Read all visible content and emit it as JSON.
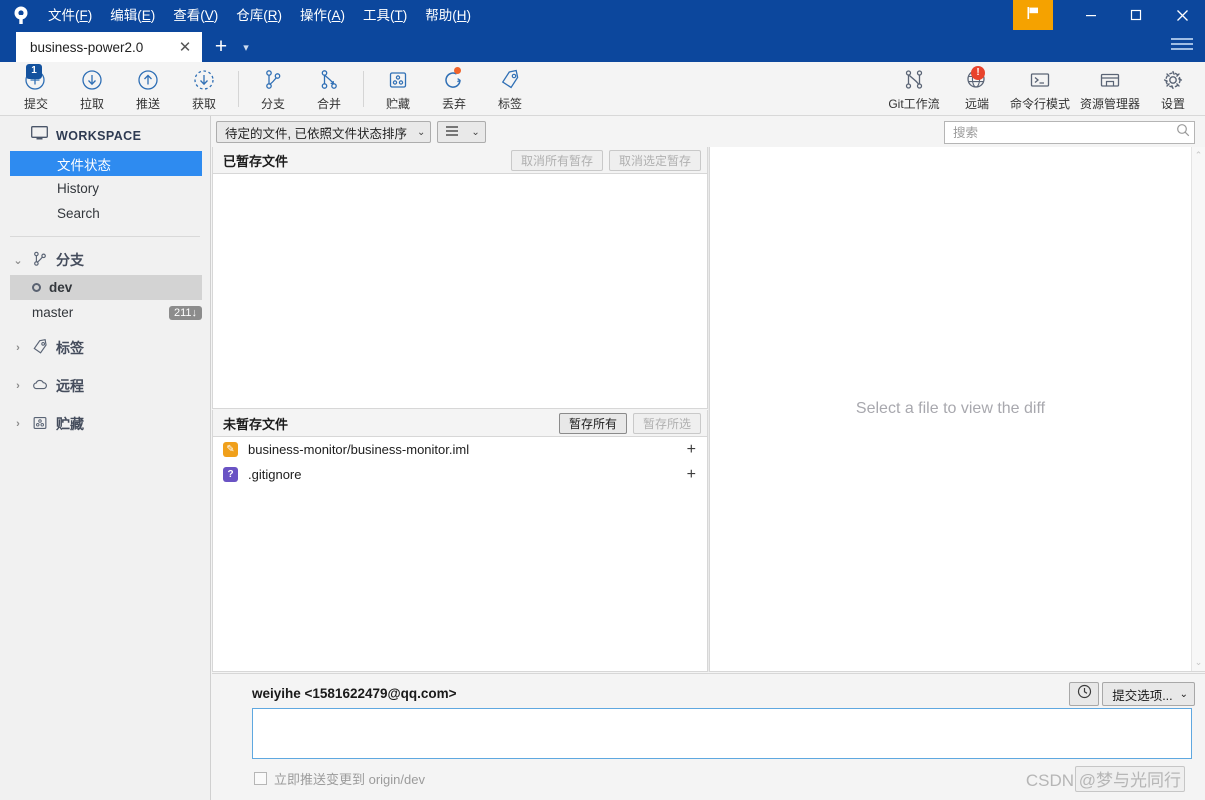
{
  "window": {
    "app_logo": "sourcetree-logo-icon",
    "minimize": "minimize-icon",
    "maximize": "maximize-icon",
    "close": "close-icon",
    "flag": "flag-icon",
    "hamburger": "hamburger-menu-icon",
    "menus": [
      {
        "label": "文件",
        "accel": "F"
      },
      {
        "label": "编辑",
        "accel": "E"
      },
      {
        "label": "查看",
        "accel": "V"
      },
      {
        "label": "仓库",
        "accel": "R"
      },
      {
        "label": "操作",
        "accel": "A"
      },
      {
        "label": "工具",
        "accel": "T"
      },
      {
        "label": "帮助",
        "accel": "H"
      }
    ]
  },
  "tabs": {
    "active": "business-power2.0",
    "close_label": "✕",
    "add_label": "+",
    "caret_label": "▾"
  },
  "toolbar": {
    "left": [
      {
        "label": "提交",
        "icon": "commit-plus-icon",
        "badge": "1"
      },
      {
        "label": "拉取",
        "icon": "pull-down-arrow-icon"
      },
      {
        "label": "推送",
        "icon": "push-up-arrow-icon"
      },
      {
        "label": "获取",
        "icon": "fetch-dashed-arrow-icon"
      },
      {
        "label": "分支",
        "icon": "branch-icon"
      },
      {
        "label": "合并",
        "icon": "merge-icon"
      },
      {
        "label": "贮藏",
        "icon": "stash-icon"
      },
      {
        "label": "丢弃",
        "icon": "discard-refresh-icon",
        "dot": true
      },
      {
        "label": "标签",
        "icon": "tag-icon"
      }
    ],
    "right": [
      {
        "label": "Git工作流",
        "icon": "gitflow-icon"
      },
      {
        "label": "远端",
        "icon": "remote-globe-icon",
        "alert": "!"
      },
      {
        "label": "命令行模式",
        "icon": "terminal-icon"
      },
      {
        "label": "资源管理器",
        "icon": "explorer-folder-icon"
      },
      {
        "label": "设置",
        "icon": "gear-icon"
      }
    ]
  },
  "sidebar": {
    "workspace_label": "WORKSPACE",
    "workspace_icon": "monitor-icon",
    "workspace_items": [
      {
        "label": "文件状态",
        "selected": true
      },
      {
        "label": "History",
        "selected": false
      },
      {
        "label": "Search",
        "selected": false
      }
    ],
    "groups": [
      {
        "label": "分支",
        "icon": "branch-icon",
        "expanded": true,
        "chevron": "⌄",
        "branches": [
          {
            "name": "dev",
            "current": true,
            "badge": ""
          },
          {
            "name": "master",
            "current": false,
            "badge": "211↓"
          }
        ]
      },
      {
        "label": "标签",
        "icon": "tag-icon",
        "expanded": false,
        "chevron": "›",
        "branches": []
      },
      {
        "label": "远程",
        "icon": "cloud-icon",
        "expanded": false,
        "chevron": "›",
        "branches": []
      },
      {
        "label": "贮藏",
        "icon": "stash-icon",
        "expanded": false,
        "chevron": "›",
        "branches": []
      }
    ]
  },
  "filterbar": {
    "sort_value": "待定的文件, 已依照文件状态排序",
    "sort_caret": "⌄",
    "view_icon": "list-view-icon",
    "view_caret": "⌄"
  },
  "search": {
    "placeholder": "搜索",
    "value": "",
    "icon": "search-icon"
  },
  "staged": {
    "title": "已暂存文件",
    "unstage_all_label": "取消所有暂存",
    "unstage_selected_label": "取消选定暂存",
    "files": []
  },
  "unstaged": {
    "title": "未暂存文件",
    "stage_all_label": "暂存所有",
    "stage_selected_label": "暂存所选",
    "files": [
      {
        "path": "business-monitor/business-monitor.iml",
        "status": "modified",
        "status_glyph": "✎",
        "add_glyph": "+"
      },
      {
        "path": ".gitignore",
        "status": "untracked",
        "status_glyph": "?",
        "add_glyph": "+"
      }
    ]
  },
  "diff": {
    "empty_message": "Select a file to view the diff",
    "scroll_up": "⌃",
    "scroll_down": "⌄"
  },
  "commit": {
    "author": "weiyihe <1581622479@qq.com>",
    "message": "",
    "message_placeholder": "",
    "history_icon": "clock-icon",
    "options_label": "提交选项...",
    "options_caret": "⌄",
    "push_checkbox_label": "立即推送变更到 origin/dev",
    "push_checked": false,
    "commit_button_label": ""
  },
  "watermark": "CSDN @梦与光同行",
  "colors": {
    "titlebar": "#0c479d",
    "accent_selected": "#2e8bf0",
    "flag_orange": "#f5a200",
    "modified_orange": "#f0a01b",
    "untracked_purple": "#6a53c4",
    "alert_red": "#e8432c",
    "badge_blue": "#14529e"
  }
}
